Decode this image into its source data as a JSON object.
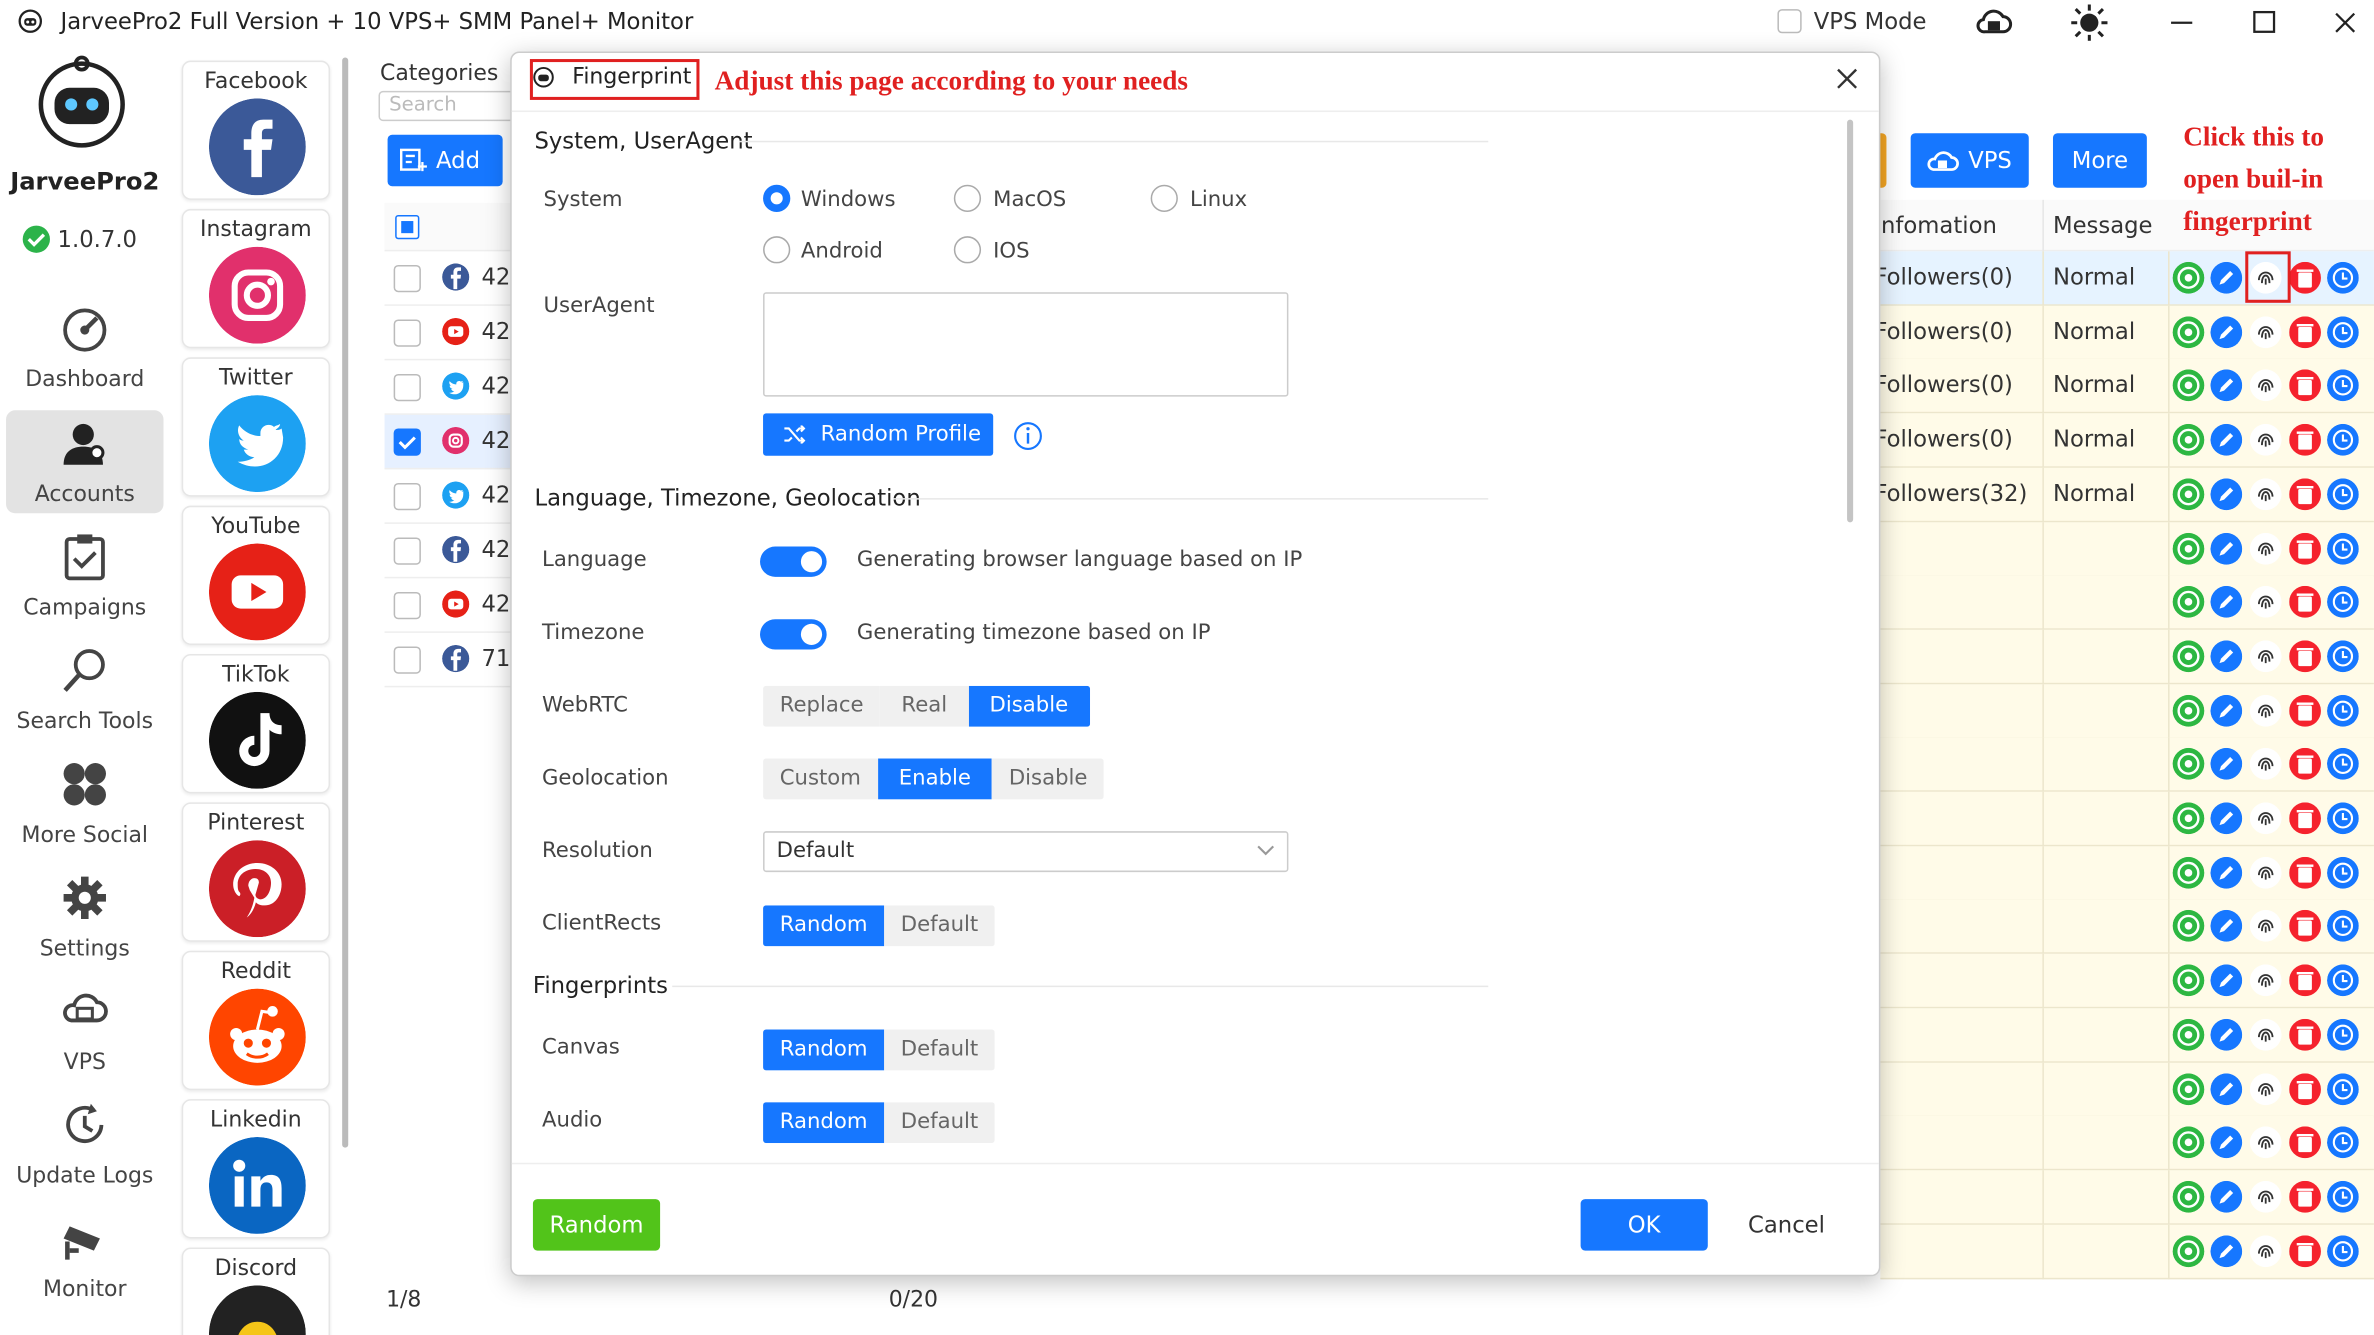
{
  "window": {
    "title": "JarveePro2 Full Version + 10 VPS+ SMM Panel+ Monitor",
    "vps_mode_label": "VPS Mode"
  },
  "sidebar": {
    "app_name": "JarveePro2",
    "version": "1.0.7.0",
    "items": [
      {
        "label": "Dashboard",
        "icon": "dashboard-icon"
      },
      {
        "label": "Accounts",
        "icon": "accounts-icon",
        "active": true
      },
      {
        "label": "Campaigns",
        "icon": "campaigns-icon"
      },
      {
        "label": "Search Tools",
        "icon": "search-tools-icon"
      },
      {
        "label": "More Social",
        "icon": "more-social-icon"
      },
      {
        "label": "Settings",
        "icon": "gear-icon"
      },
      {
        "label": "VPS",
        "icon": "vps-icon"
      },
      {
        "label": "Update Logs",
        "icon": "update-logs-icon"
      },
      {
        "label": "Monitor",
        "icon": "monitor-icon"
      }
    ]
  },
  "social": {
    "platforms": [
      {
        "name": "Facebook",
        "color": "#3b5998"
      },
      {
        "name": "Instagram",
        "color": "#e1306c"
      },
      {
        "name": "Twitter",
        "color": "#1da1f2"
      },
      {
        "name": "YouTube",
        "color": "#e62117"
      },
      {
        "name": "TikTok",
        "color": "#111111"
      },
      {
        "name": "Pinterest",
        "color": "#cb1f27"
      },
      {
        "name": "Reddit",
        "color": "#ff4500"
      },
      {
        "name": "Linkedin",
        "color": "#0a66c2"
      },
      {
        "name": "Discord",
        "color": "#222222"
      }
    ]
  },
  "categories": {
    "title": "Categories",
    "search_placeholder": "Search",
    "add_label": "Add",
    "page_count": "1/8",
    "selected_count": "0/20"
  },
  "account_rows": [
    {
      "platform": "facebook",
      "id": "42"
    },
    {
      "platform": "youtube",
      "id": "42"
    },
    {
      "platform": "twitter",
      "id": "42"
    },
    {
      "platform": "instagram",
      "id": "42",
      "checked": true
    },
    {
      "platform": "twitter",
      "id": "42"
    },
    {
      "platform": "facebook",
      "id": "42"
    },
    {
      "platform": "youtube",
      "id": "42"
    },
    {
      "platform": "facebook",
      "id": "71"
    }
  ],
  "table": {
    "vps_button": "VPS",
    "more_button": "More",
    "col_information": "Infomation",
    "col_message": "Message",
    "rows": [
      {
        "info": "Followers(0)",
        "message": "Normal"
      },
      {
        "info": "Followers(0)",
        "message": "Normal"
      },
      {
        "info": "Followers(0)",
        "message": "Normal"
      },
      {
        "info": "Followers(0)",
        "message": "Normal"
      },
      {
        "info": "Followers(32)",
        "message": "Normal"
      }
    ]
  },
  "annotations": {
    "adjust_note": "Adjust this page according to your needs",
    "click_note_line1": "Click this to",
    "click_note_line2": "open buil-in",
    "click_note_line3": "fingerprint"
  },
  "dialog": {
    "title": "Fingerprint",
    "section_system": "System, UserAgent",
    "system_label": "System",
    "system_options": [
      "Windows",
      "MacOS",
      "Linux",
      "Android",
      "IOS"
    ],
    "system_selected": "Windows",
    "useragent_label": "UserAgent",
    "useragent_value": "",
    "random_profile_button": "Random Profile",
    "section_lang": "Language, Timezone, Geolocation",
    "language_label": "Language",
    "language_desc": "Generating browser language based on IP",
    "language_on": true,
    "timezone_label": "Timezone",
    "timezone_desc": "Generating timezone based on IP",
    "timezone_on": true,
    "webrtc_label": "WebRTC",
    "webrtc_options": [
      "Replace",
      "Real",
      "Disable"
    ],
    "webrtc_selected": "Disable",
    "geolocation_label": "Geolocation",
    "geolocation_options": [
      "Custom",
      "Enable",
      "Disable"
    ],
    "geolocation_selected": "Enable",
    "resolution_label": "Resolution",
    "resolution_value": "Default",
    "clientrects_label": "ClientRects",
    "clientrects_options": [
      "Random",
      "Default"
    ],
    "clientrects_selected": "Random",
    "section_fingerprints": "Fingerprints",
    "canvas_label": "Canvas",
    "canvas_options": [
      "Random",
      "Default"
    ],
    "canvas_selected": "Random",
    "audio_label": "Audio",
    "audio_options": [
      "Random",
      "Default"
    ],
    "audio_selected": "Random",
    "random_button": "Random",
    "ok_button": "OK",
    "cancel_button": "Cancel"
  }
}
